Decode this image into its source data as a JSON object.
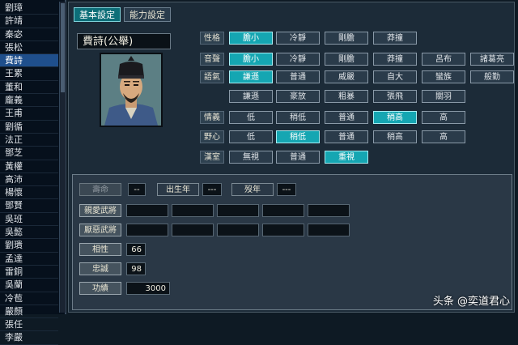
{
  "officer_list": [
    "劉璋",
    "許靖",
    "秦宓",
    "張松",
    "費詩",
    "王累",
    "董和",
    "龐義",
    "王甫",
    "劉循",
    "法正",
    "鄧芝",
    "黃權",
    "高沛",
    "楊懷",
    "鄧賢",
    "吳班",
    "吳懿",
    "劉璝",
    "孟達",
    "雷銅",
    "吳蘭",
    "冷苞",
    "嚴顏",
    "張任",
    "李嚴"
  ],
  "selected_officer": "費詩",
  "tabs": {
    "basic": "基本設定",
    "ability": "能力設定"
  },
  "officer_name": "費詩(公舉)",
  "portrait_icon": "officer-portrait",
  "traits": [
    {
      "label": "性格",
      "options": [
        "膽小",
        "冷靜",
        "剛膽",
        "莽撞"
      ],
      "selected": 0
    },
    {
      "label": "音聲",
      "options": [
        "膽小",
        "冷靜",
        "剛膽",
        "莽撞",
        "呂布",
        "諸葛亮"
      ],
      "selected": 0
    },
    {
      "label": "語氣",
      "options": [
        "謙遜",
        "普通",
        "威嚴",
        "自大",
        "蠻族",
        "般勤"
      ],
      "selected": 0
    },
    {
      "label": "",
      "options": [
        "謙遜",
        "豪放",
        "粗暴",
        "張飛",
        "關羽"
      ],
      "selected": -1
    },
    {
      "label": "情義",
      "options": [
        "低",
        "稍低",
        "普通",
        "稍高",
        "高"
      ],
      "selected": 3
    },
    {
      "label": "野心",
      "options": [
        "低",
        "稍低",
        "普通",
        "稍高",
        "高"
      ],
      "selected": 1
    },
    {
      "label": "漢室",
      "options": [
        "無視",
        "普通",
        "重視"
      ],
      "selected": 2
    }
  ],
  "lower": {
    "life_label": "壽命",
    "life_value": "--",
    "birth_label": "出生年",
    "birth_value": "---",
    "death_label": "歿年",
    "death_value": "---",
    "friendly_label": "親愛武將",
    "hostile_label": "厭惡武將",
    "compat_label": "相性",
    "compat_value": "66",
    "loyalty_label": "忠誠",
    "loyalty_value": "98",
    "merit_label": "功績",
    "merit_value": "3000"
  },
  "watermark": "头条 @奕道君心",
  "colors": {
    "selected_option": "#15a6b2",
    "selected_list_item": "#1f4f8c",
    "panel_bg": "#1c2b38"
  }
}
